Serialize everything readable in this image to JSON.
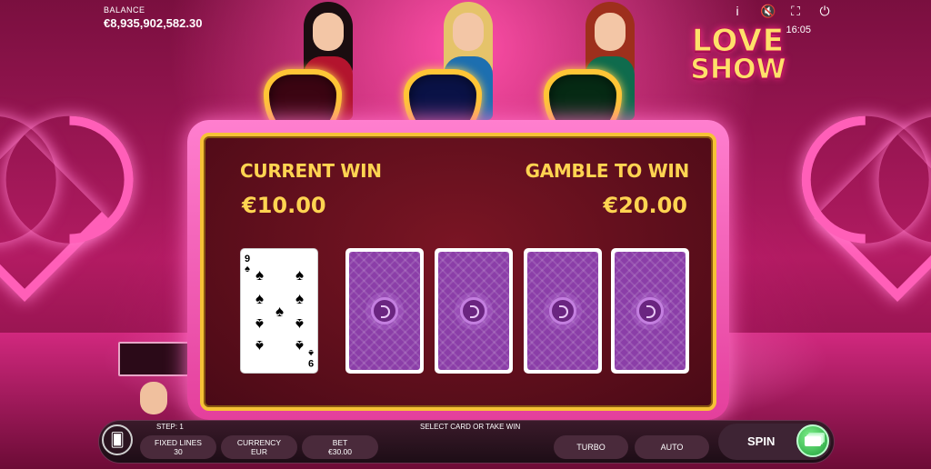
{
  "header": {
    "balance_label": "BALANCE",
    "balance_value": "€8,935,902,582.30",
    "time": "16:05",
    "icons": [
      "info-icon",
      "mute-icon",
      "fullscreen-icon",
      "power-icon"
    ]
  },
  "logo": {
    "line1": "LOVE",
    "line2": "SHOW"
  },
  "gamble": {
    "current_win_label": "CURRENT WIN",
    "current_win_value": "€10.00",
    "gamble_to_win_label": "GAMBLE TO WIN",
    "gamble_to_win_value": "€20.00",
    "dealer_card": {
      "rank": "9",
      "suit": "♠"
    },
    "face_down_cards": 4
  },
  "footer": {
    "step": "STEP: 1",
    "hint": "SELECT CARD OR TAKE WIN",
    "fixed_lines_label": "FIXED LINES",
    "fixed_lines_value": "30",
    "currency_label": "CURRENCY",
    "currency_value": "EUR",
    "bet_label": "BET",
    "bet_value": "€30.00",
    "turbo_label": "TURBO",
    "auto_label": "AUTO",
    "spin_label": "SPIN"
  },
  "colors": {
    "accent_gold": "#ffd451",
    "panel_border": "#f6c236",
    "card_back": "#8b3ea8",
    "spin_green": "#1e9e3a"
  }
}
